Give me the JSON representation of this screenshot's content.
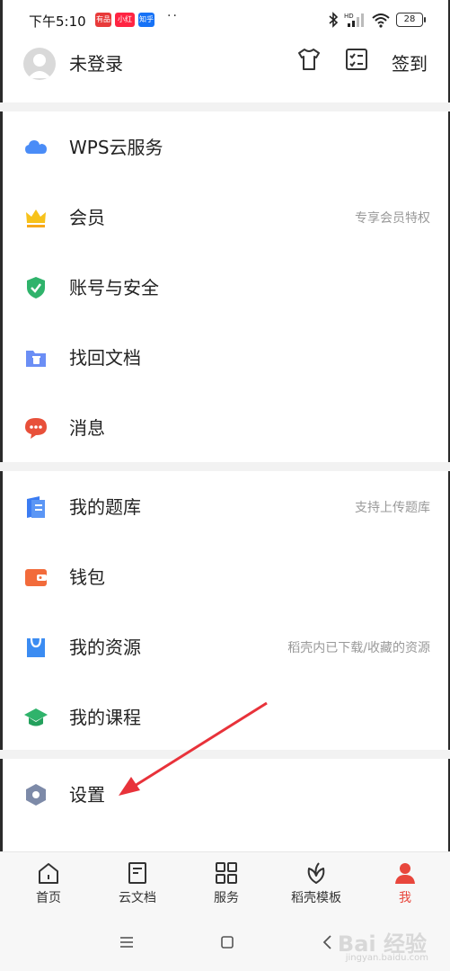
{
  "status_bar": {
    "time": "下午5:10",
    "apps": [
      "有品",
      "小红书",
      "知乎"
    ],
    "battery": "28"
  },
  "header": {
    "login_text": "未登录",
    "checkin_label": "签到",
    "icons": [
      "tshirt-icon",
      "checklist-icon"
    ]
  },
  "menu_groups": [
    [
      {
        "label": "WPS云服务",
        "hint": "",
        "icon": "cloud-icon",
        "color": "#4a8cf7"
      },
      {
        "label": "会员",
        "hint": "专享会员特权",
        "icon": "crown-icon",
        "color": "#f7c21b"
      },
      {
        "label": "账号与安全",
        "hint": "",
        "icon": "shield-icon",
        "color": "#2fb36b"
      },
      {
        "label": "找回文档",
        "hint": "",
        "icon": "folder-recover-icon",
        "color": "#6b8ef5"
      },
      {
        "label": "消息",
        "hint": "",
        "icon": "chat-bubble-icon",
        "color": "#e8503a"
      }
    ],
    [
      {
        "label": "我的题库",
        "hint": "支持上传题库",
        "icon": "question-bank-icon",
        "color": "#3b7cf2"
      },
      {
        "label": "钱包",
        "hint": "",
        "icon": "wallet-icon",
        "color": "#f26b3b"
      },
      {
        "label": "我的资源",
        "hint": "稻壳内已下载/收藏的资源",
        "icon": "shopping-bag-icon",
        "color": "#3b8cf2"
      },
      {
        "label": "我的课程",
        "hint": "",
        "icon": "graduation-cap-icon",
        "color": "#2fb36b"
      }
    ],
    [
      {
        "label": "设置",
        "hint": "",
        "icon": "settings-hex-icon",
        "color": "#7d8aa8"
      }
    ]
  ],
  "tabs": [
    {
      "label": "首页",
      "icon": "home-icon",
      "active": false
    },
    {
      "label": "云文档",
      "icon": "cloud-doc-icon",
      "active": false
    },
    {
      "label": "服务",
      "icon": "grid-icon",
      "active": false
    },
    {
      "label": "稻壳模板",
      "icon": "leaf-icon",
      "active": false
    },
    {
      "label": "我",
      "icon": "user-icon",
      "active": true
    }
  ],
  "colors": {
    "accent": "#e8463c",
    "annotation_arrow": "#e8323a"
  },
  "watermark": {
    "main": "Bai 经验",
    "sub": "jingyan.baidu.com"
  }
}
